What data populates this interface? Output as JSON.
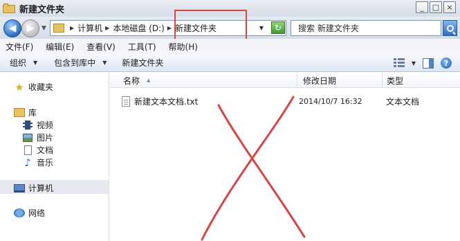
{
  "window": {
    "title": "新建文件夹",
    "controls": [
      "_",
      "□",
      "×"
    ]
  },
  "address": {
    "crumbs": [
      "计算机",
      "本地磁盘 (D:)",
      "新建文件夹"
    ],
    "search_placeholder": "搜索 新建文件夹"
  },
  "menu": [
    "文件(F)",
    "编辑(E)",
    "查看(V)",
    "工具(T)",
    "帮助(H)"
  ],
  "commands": {
    "organize": "组织",
    "include_in_library": "包含到库中",
    "new_folder": "新建文件夹"
  },
  "nav": {
    "favorites": "收藏夹",
    "libraries": "库",
    "library_items": [
      "视频",
      "图片",
      "文档",
      "音乐"
    ],
    "computer": "计算机",
    "network": "网络"
  },
  "columns": {
    "name": "名称",
    "date": "修改日期",
    "type": "类型"
  },
  "files": [
    {
      "name": "新建文本文档.txt",
      "date": "2014/10/7 16:32",
      "type": "文本文档"
    }
  ],
  "colors": {
    "annotation_red": "#e0413b",
    "x_mark": "#d9453e"
  }
}
